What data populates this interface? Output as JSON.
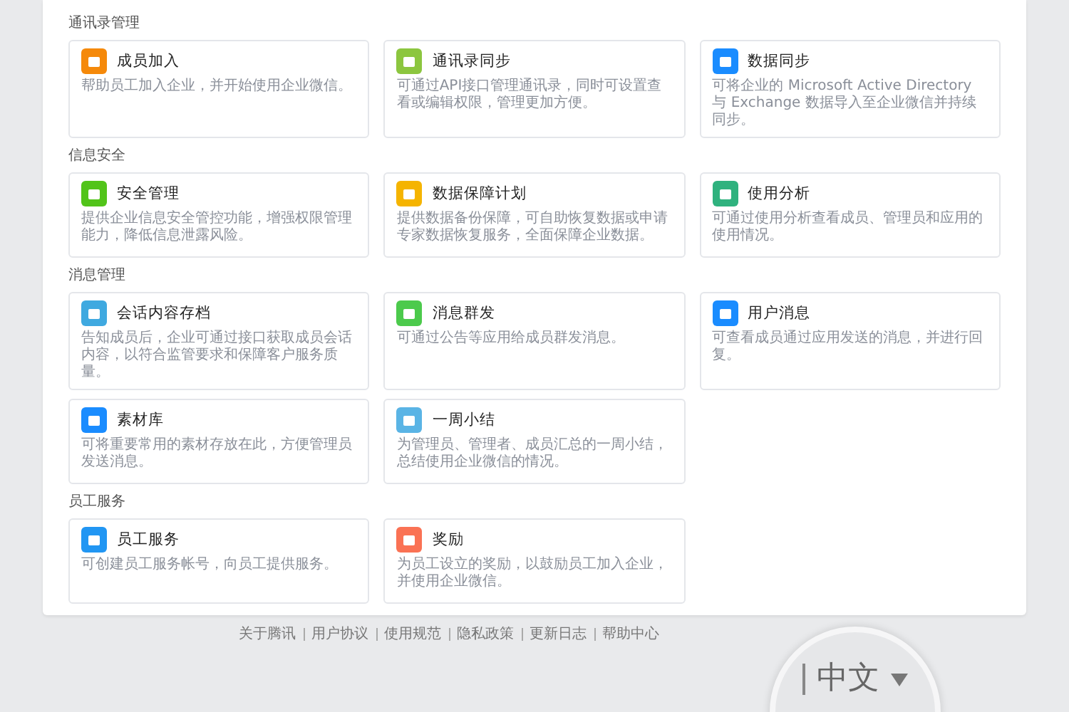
{
  "sections": [
    {
      "title": "通讯录管理",
      "cards": [
        {
          "title": "成员加入",
          "description": "帮助员工加入企业，并开始使用企业微信。",
          "color": "#f5890a"
        },
        {
          "title": "通讯录同步",
          "description": "可通过API接口管理通讯录，同时可设置查看或编辑权限，管理更加方便。",
          "color": "#8cc63f"
        },
        {
          "title": "数据同步",
          "description": "可将企业的 Microsoft Active Directory 与 Exchange 数据导入至企业微信并持续同步。",
          "color": "#1a8cff"
        }
      ]
    },
    {
      "title": "信息安全",
      "cards": [
        {
          "title": "安全管理",
          "description": "提供企业信息安全管控功能，增强权限管理能力，降低信息泄露风险。",
          "color": "#52c41a"
        },
        {
          "title": "数据保障计划",
          "description": "提供数据备份保障，可自助恢复数据或申请专家数据恢复服务，全面保障企业数据。",
          "color": "#f5b400"
        },
        {
          "title": "使用分析",
          "description": "可通过使用分析查看成员、管理员和应用的使用情况。",
          "color": "#2fb27e"
        }
      ]
    },
    {
      "title": "消息管理",
      "cards": [
        {
          "title": "会话内容存档",
          "description": "告知成员后，企业可通过接口获取成员会话内容，以符合监管要求和保障客户服务质量。",
          "color": "#3fa9e0"
        },
        {
          "title": "消息群发",
          "description": "可通过公告等应用给成员群发消息。",
          "color": "#4cca4c"
        },
        {
          "title": "用户消息",
          "description": "可查看成员通过应用发送的消息，并进行回复。",
          "color": "#1a8cff"
        },
        {
          "title": "素材库",
          "description": "可将重要常用的素材存放在此，方便管理员发送消息。",
          "color": "#1a8cff"
        },
        {
          "title": "一周小结",
          "description": "为管理员、管理者、成员汇总的一周小结，总结使用企业微信的情况。",
          "color": "#5ab4e5"
        }
      ]
    },
    {
      "title": "员工服务",
      "cards": [
        {
          "title": "员工服务",
          "description": "可创建员工服务帐号，向员工提供服务。",
          "color": "#2196f3"
        },
        {
          "title": "奖励",
          "description": "为员工设立的奖励，以鼓励员工加入企业，并使用企业微信。",
          "color": "#fa7254"
        }
      ]
    }
  ],
  "footer_links": [
    "关于腾讯",
    "用户协议",
    "使用规范",
    "隐私政策",
    "更新日志",
    "帮助中心"
  ],
  "language_magnifier": {
    "label": "中文"
  }
}
